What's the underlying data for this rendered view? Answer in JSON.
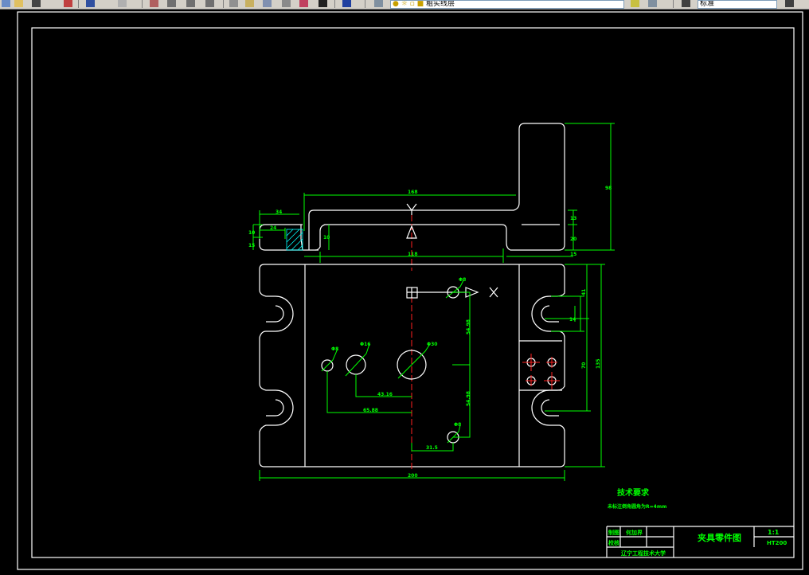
{
  "toolbar": {
    "layer_dropdown": "粗实线层",
    "style_dropdown": "标准"
  },
  "drawing": {
    "axis_x": "X",
    "axis_y": "Y",
    "dims": {
      "top_length": "168",
      "bottom_length": "118",
      "left_a": "34",
      "left_b": "24",
      "left_h1": "10",
      "left_h2": "15",
      "inner_h": "10",
      "right_h1": "13",
      "right_h2": "20",
      "right_w": "15",
      "tall_h": "98",
      "v_gap": "41",
      "slot_w": "14",
      "mid_h": "70",
      "total_h": "135",
      "total_w": "200",
      "horiz_1": "43.16",
      "horiz_2": "65.88",
      "horiz_3": "31.5",
      "vert_1": "54.98",
      "vert_2": "54.98",
      "dia_1": "Φ8",
      "dia_2": "Φ16",
      "dia_3": "Φ30",
      "dia_4": "Φ8",
      "dia_5": "Φ8"
    }
  },
  "notes": {
    "title": "技术要求",
    "text": "未标注倒角圆角为R=4mm"
  },
  "title_block": {
    "drawn_label": "制图",
    "drawn_name": "何加界",
    "check_label": "校核",
    "drawing_title": "夹具零件图",
    "scale": "1:1",
    "material": "HT200",
    "school": "辽宁工程技术大学"
  }
}
